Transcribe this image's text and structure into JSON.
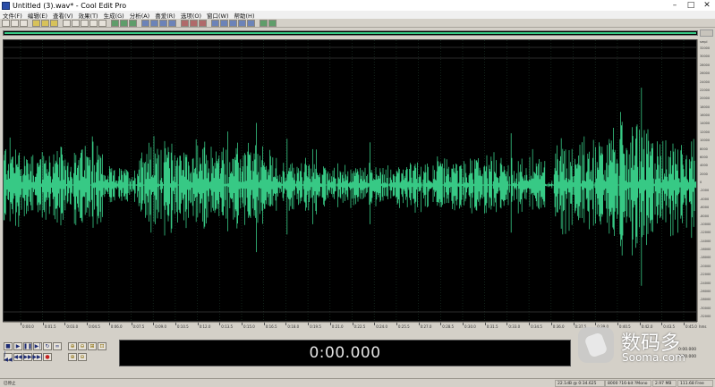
{
  "window": {
    "title": "Untitled (3).wav* - Cool Edit Pro",
    "minimize": "–",
    "maximize": "□",
    "close": "✕"
  },
  "menu": [
    "文件(F)",
    "编辑(E)",
    "查看(V)",
    "效果(T)",
    "生成(G)",
    "分析(A)",
    "喜爱(R)",
    "选项(O)",
    "窗口(W)",
    "帮助(H)"
  ],
  "toolbar": {
    "buttons": [
      "new",
      "open",
      "save",
      "y1",
      "y2",
      "y3",
      "cut",
      "copy",
      "paste",
      "mix",
      "trim",
      "g1",
      "g2",
      "g3",
      "b1",
      "b2",
      "b3",
      "b4",
      "r1",
      "r2",
      "r3",
      "b5",
      "b6",
      "b7",
      "b8",
      "b9",
      "g4",
      "g5"
    ]
  },
  "waveform": {
    "color": "#37c985",
    "amplitude_units": "smpl",
    "amplitude_ticks": [
      "32000",
      "30000",
      "28000",
      "26000",
      "24000",
      "22000",
      "20000",
      "18000",
      "16000",
      "14000",
      "12000",
      "10000",
      "8000",
      "6000",
      "4000",
      "2000",
      "0",
      "-2000",
      "-4000",
      "-6000",
      "-8000",
      "-10000",
      "-12000",
      "-14000",
      "-16000",
      "-18000",
      "-20000",
      "-22000",
      "-24000",
      "-26000",
      "-28000",
      "-30000",
      "-32000"
    ]
  },
  "timeline": {
    "labels": [
      "0:00.0",
      "0:01.5",
      "0:03.0",
      "0:04.5",
      "0:06.0",
      "0:07.5",
      "0:09.0",
      "0:10.5",
      "0:12.0",
      "0:13.5",
      "0:15.0",
      "0:16.5",
      "0:18.0",
      "0:19.5",
      "0:21.0",
      "0:22.5",
      "0:24.0",
      "0:25.5",
      "0:27.0",
      "0:28.5",
      "0:30.0",
      "0:31.5",
      "0:33.0",
      "0:34.5",
      "0:36.0",
      "0:37.5",
      "0:39.0",
      "0:40.5",
      "0:42.0",
      "0:43.5",
      "0:45.0"
    ],
    "unit": "hms"
  },
  "transport": {
    "play": "▶",
    "play_to_end": "▶|",
    "pause": "❚❚",
    "loop": "↻",
    "loop_play": "∞",
    "stop": "■",
    "go_start": "|◀◀",
    "rewind": "◀◀",
    "fast_forward": "▶▶",
    "go_end": "▶▶|",
    "record": "●"
  },
  "zoom": {
    "zoom_in_h": "⊕",
    "zoom_out_h": "⊖",
    "zoom_full": "⊞",
    "zoom_in_v": "⊕",
    "zoom_out_v": "⊖",
    "zoom_sel": "⊡"
  },
  "time_display": "0:00.000",
  "selection": {
    "begin": "0:00.000",
    "end": "",
    "length": "0:00.000"
  },
  "watermark": {
    "cn": "数码多",
    "en": "Sooma.com"
  },
  "status": {
    "left": "已停止",
    "cells": [
      "22.1dB @ 0:34.625",
      "8000 ?16-bit ?Mono",
      "2.97 MB",
      "111.68 Free"
    ]
  }
}
